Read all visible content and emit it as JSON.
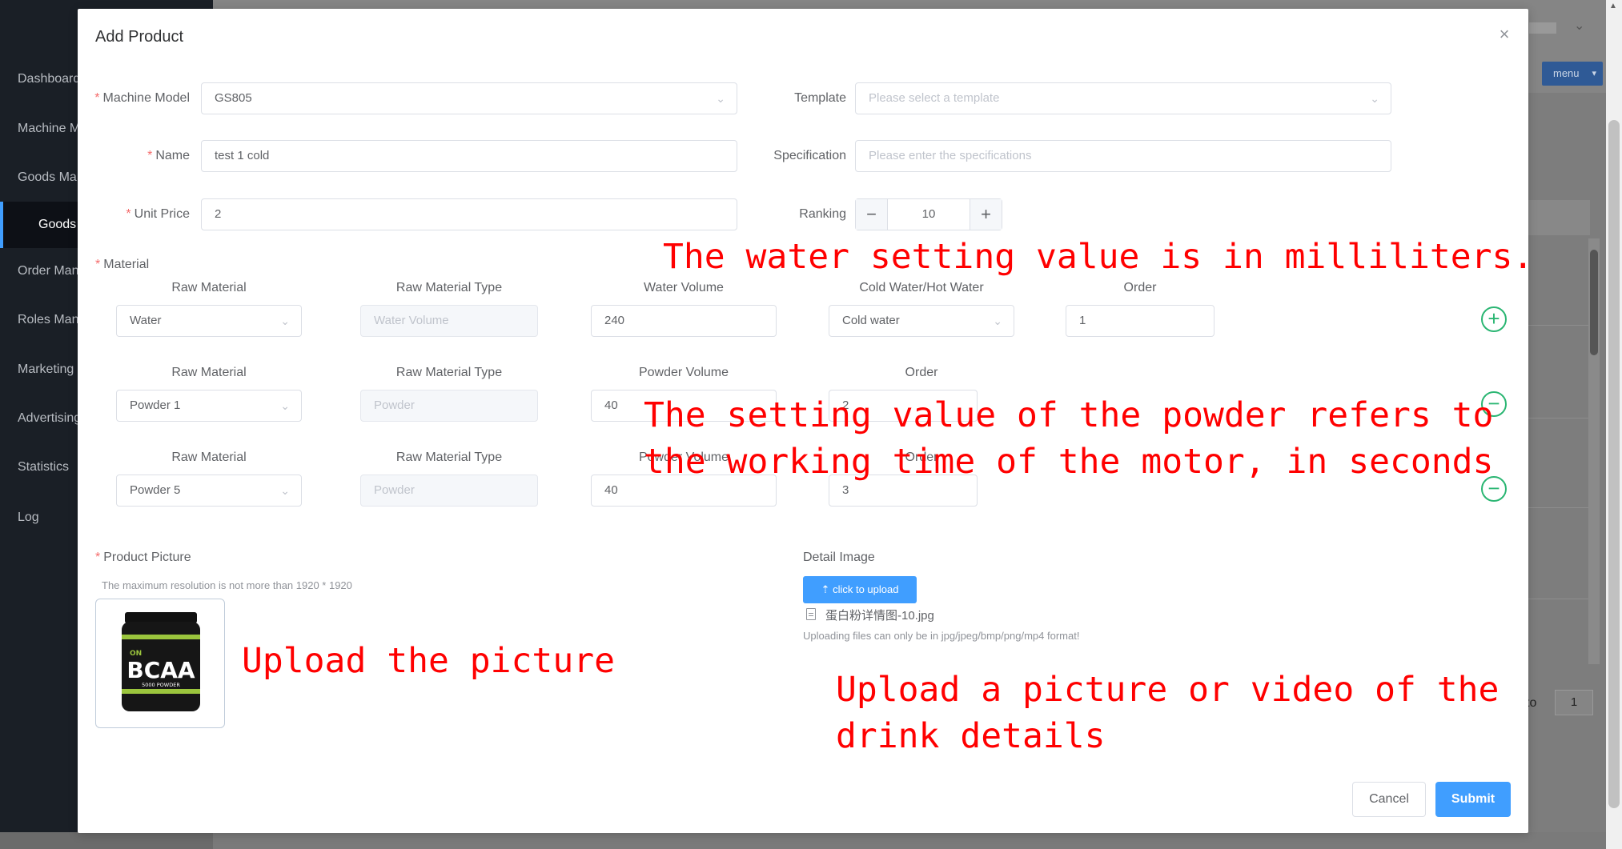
{
  "sidebar": {
    "items": [
      {
        "label": "Dashboard"
      },
      {
        "label": "Machine Management"
      },
      {
        "label": "Goods Management"
      },
      {
        "label": "Goods List"
      },
      {
        "label": "Order Management"
      },
      {
        "label": "Roles Management"
      },
      {
        "label": "Marketing"
      },
      {
        "label": "Advertising"
      },
      {
        "label": "Statistics"
      },
      {
        "label": "Log"
      }
    ]
  },
  "background": {
    "menu_label": "menu",
    "pager_label": "to",
    "pager_value": "1"
  },
  "modal": {
    "title": "Add Product",
    "close_icon": "×",
    "fields": {
      "machine_model": {
        "label": "Machine Model",
        "value": "GS805"
      },
      "template": {
        "label": "Template",
        "placeholder": "Please select a template"
      },
      "name": {
        "label": "Name",
        "value": "test 1 cold"
      },
      "specification": {
        "label": "Specification",
        "placeholder": "Please enter the specifications"
      },
      "unit_price": {
        "label": "Unit Price",
        "value": "2"
      },
      "ranking": {
        "label": "Ranking",
        "value": "10"
      }
    },
    "material": {
      "label": "Material",
      "rows": [
        {
          "headers": [
            "Raw Material",
            "Raw Material Type",
            "Water Volume",
            "Cold Water/Hot Water",
            "Order"
          ],
          "raw_material": "Water",
          "type": "Water Volume",
          "volume": "240",
          "temp": "Cold water",
          "order": "1"
        },
        {
          "headers": [
            "Raw Material",
            "Raw Material Type",
            "Powder Volume",
            "Order"
          ],
          "raw_material": "Powder 1",
          "type": "Powder",
          "volume": "40",
          "order": "2"
        },
        {
          "headers": [
            "Raw Material",
            "Raw Material Type",
            "Powder Volume",
            "Order"
          ],
          "raw_material": "Powder 5",
          "type": "Powder",
          "volume": "40",
          "order": "3"
        }
      ]
    },
    "product_picture": {
      "label": "Product Picture",
      "hint": "The maximum resolution is not more than 1920 * 1920",
      "jar_brand": "ON",
      "jar_text": "BCAA",
      "jar_subtext": "5000 POWDER"
    },
    "detail_image": {
      "label": "Detail Image",
      "upload_label": "click to upload",
      "file_name": "蛋白粉详情图-10.jpg",
      "hint": "Uploading files can only be in jpg/jpeg/bmp/png/mp4 format!"
    },
    "buttons": {
      "cancel": "Cancel",
      "submit": "Submit"
    }
  },
  "annotations": {
    "water": "The water setting value is in milliliters.",
    "powder_line1": "The setting value of the powder refers to",
    "powder_line2": "the working time of the motor, in seconds",
    "upload_picture": "Upload the picture",
    "detail_line1": "Upload a picture or video of the",
    "detail_line2": "drink details"
  },
  "colors": {
    "primary": "#409eff",
    "required": "#f56c6c",
    "add_remove": "#2bb673",
    "annotation": "#ff0000"
  }
}
